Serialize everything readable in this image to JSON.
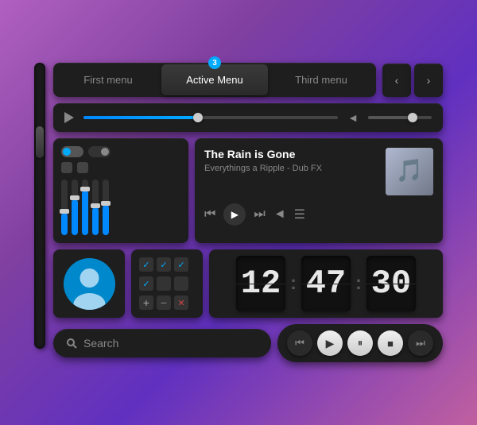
{
  "nav": {
    "items": [
      {
        "label": "First menu",
        "active": false
      },
      {
        "label": "Active Menu",
        "active": true
      },
      {
        "label": "Third menu",
        "active": false
      }
    ],
    "badge": "3",
    "prev_label": "‹",
    "next_label": "›"
  },
  "playbar": {
    "progress_pct": 45,
    "volume_pct": 70
  },
  "media_player": {
    "title": "The Rain is Gone",
    "subtitle": "Everythings a Ripple - Dub FX",
    "album_art_label": "🎵"
  },
  "countdown": {
    "hours": "12",
    "minutes": "47",
    "seconds": "30"
  },
  "search": {
    "placeholder": "Search"
  },
  "media_buttons": {
    "rewind": "⏮",
    "play": "▶",
    "pause": "⏸",
    "stop": "■",
    "forward": "⏭"
  }
}
